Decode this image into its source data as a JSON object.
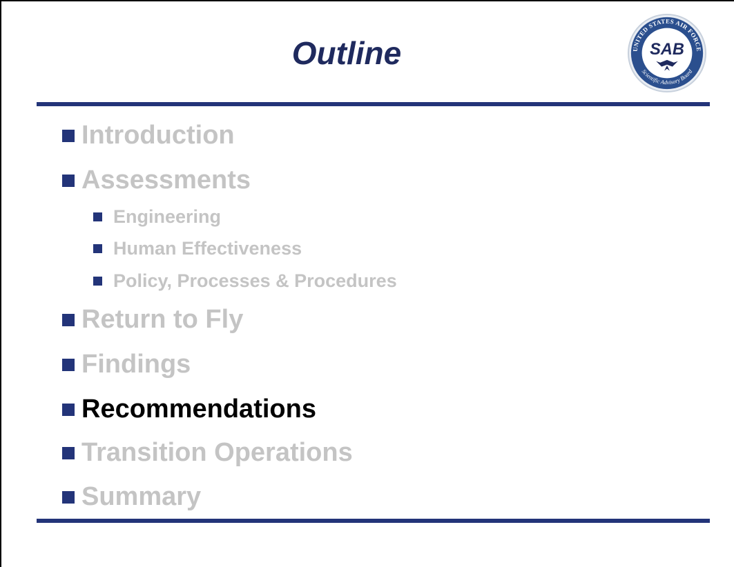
{
  "slide": {
    "title": "Outline",
    "logo": {
      "ring_text_top": "UNITED STATES AIR FORCE",
      "ring_text_bottom": "Scientific Advisory Board",
      "center_text": "SAB"
    },
    "outline": [
      {
        "label": "Introduction",
        "level": 1,
        "active": false
      },
      {
        "label": "Assessments",
        "level": 1,
        "active": false
      },
      {
        "label": "Engineering",
        "level": 2,
        "active": false
      },
      {
        "label": "Human Effectiveness",
        "level": 2,
        "active": false
      },
      {
        "label": "Policy, Processes & Procedures",
        "level": 2,
        "active": false
      },
      {
        "label": "Return to Fly",
        "level": 1,
        "active": false
      },
      {
        "label": "Findings",
        "level": 1,
        "active": false
      },
      {
        "label": "Recommendations",
        "level": 1,
        "active": true
      },
      {
        "label": "Transition Operations",
        "level": 1,
        "active": false
      },
      {
        "label": "Summary",
        "level": 1,
        "active": false
      }
    ]
  },
  "colors": {
    "title": "#1f2a5e",
    "rule": "#233479",
    "bullet": "#233479",
    "inactive_text": "#c4c4c4",
    "active_text": "#000000"
  }
}
